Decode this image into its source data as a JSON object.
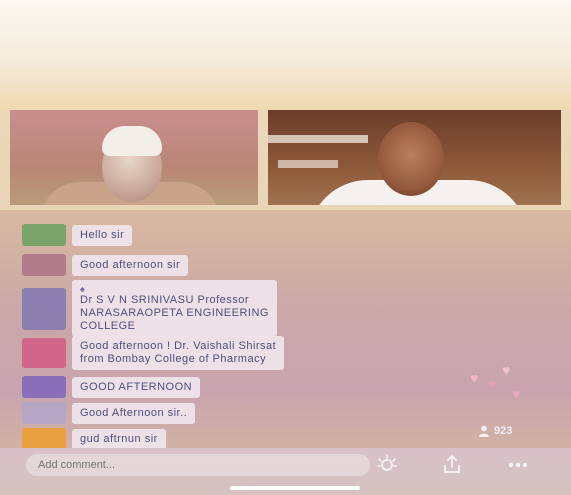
{
  "chat": {
    "messages": [
      {
        "lines": [
          "Hello sir"
        ],
        "avatar_color": "#7aa36a",
        "badge": ""
      },
      {
        "lines": [
          "Good afternoon sir"
        ],
        "avatar_color": "#b07c8a",
        "badge": ""
      },
      {
        "lines": [
          "Dr S V N SRINIVASU Professor",
          "NARASARAOPETA ENGINEERING",
          "COLLEGE"
        ],
        "avatar_color": "#8c7fb0",
        "badge": "♠"
      },
      {
        "lines": [
          "Good afternoon ! Dr. Vaishali Shirsat",
          "from Bombay College of Pharmacy"
        ],
        "avatar_color": "#d1658a",
        "badge": ""
      },
      {
        "lines": [
          "GOOD AFTERNOON"
        ],
        "avatar_color": "#8a6fb8",
        "badge": ""
      },
      {
        "lines": [
          "Good Afternoon sir.."
        ],
        "avatar_color": "#b6a6c6",
        "badge": ""
      },
      {
        "lines": [
          "gud aftrnun sir"
        ],
        "avatar_color": "#e8a040",
        "badge": ""
      }
    ]
  },
  "viewers": {
    "icon": "person-icon",
    "count": "923"
  },
  "bottom_bar": {
    "comment_placeholder": "Add comment...",
    "icons": [
      "filter-sparkle-icon",
      "share-icon",
      "more-icon"
    ]
  },
  "colors": {
    "bubble_text": "#4c4f7e",
    "bubble_bg": "#f0e4ec"
  }
}
